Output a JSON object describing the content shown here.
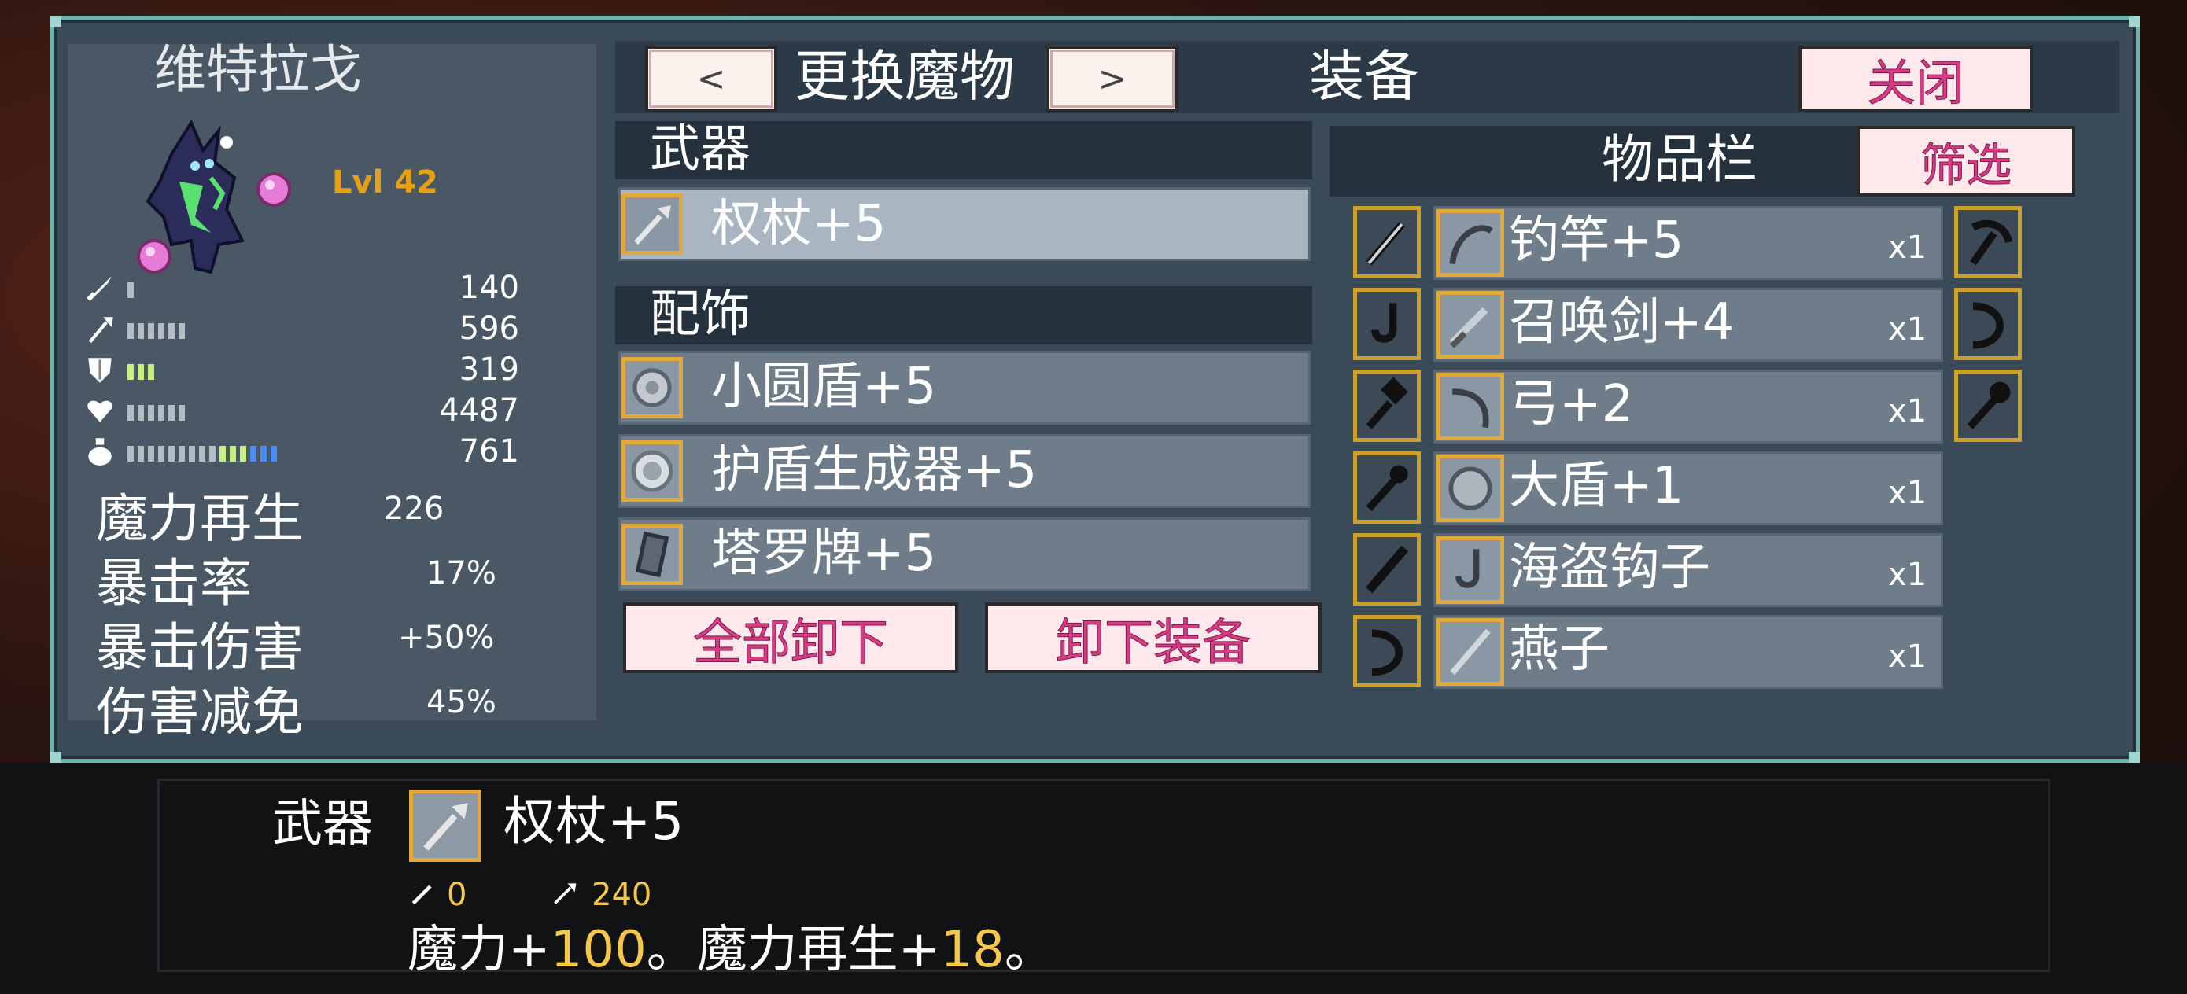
{
  "character": {
    "name": "维特拉戈",
    "level": "Lvl 42"
  },
  "stats": [
    {
      "icon": "sword-icon",
      "value": "140",
      "bars": [
        1,
        0,
        0
      ]
    },
    {
      "icon": "staff-icon",
      "value": "596",
      "bars": [
        6,
        0,
        0
      ]
    },
    {
      "icon": "shield-icon",
      "value": "319",
      "bars": [
        0,
        3,
        0
      ]
    },
    {
      "icon": "heart-icon",
      "value": "4487",
      "bars": [
        6,
        0,
        0
      ]
    },
    {
      "icon": "potion-icon",
      "value": "761",
      "bars": [
        9,
        3,
        3
      ]
    }
  ],
  "big_stats": [
    {
      "label": "魔力再生",
      "value": "226"
    },
    {
      "label": "暴击率",
      "value": "17%"
    },
    {
      "label": "暴击伤害",
      "value": "+50%"
    },
    {
      "label": "伤害减免",
      "value": "45%"
    }
  ],
  "header": {
    "prev": "<",
    "change_monster": "更换魔物",
    "next": ">",
    "title": "装备",
    "close": "关闭"
  },
  "equipment": {
    "weapon_section": "武器",
    "weapon": "权杖+5",
    "accessory_section": "配饰",
    "accessories": [
      "小圆盾+5",
      "护盾生成器+5",
      "塔罗牌+5"
    ],
    "unequip_all": "全部卸下",
    "unequip": "卸下装备"
  },
  "inventory": {
    "title": "物品栏",
    "filter": "筛选",
    "items": [
      {
        "name": "钓竿+5",
        "count": "x1",
        "icon": "fishing-rod-icon"
      },
      {
        "name": "召唤剑+4",
        "count": "x1",
        "icon": "sword-icon"
      },
      {
        "name": "弓+2",
        "count": "x1",
        "icon": "bow-icon"
      },
      {
        "name": "大盾+1",
        "count": "x1",
        "icon": "round-shield-icon"
      },
      {
        "name": "海盗钩子",
        "count": "x1",
        "icon": "hook-icon"
      },
      {
        "name": "燕子",
        "count": "x1",
        "icon": "dagger-icon"
      }
    ]
  },
  "detail": {
    "category": "武器",
    "name": "权杖+5",
    "attack": "0",
    "magic": "240",
    "desc_a": "魔力+",
    "desc_a_val": "100",
    "desc_sep": "。",
    "desc_b": "魔力再生+",
    "desc_b_val": "18",
    "desc_end": "。"
  },
  "colors": {
    "accent_pink": "#d93a86",
    "gold_border": "#e2a93a",
    "highlight_yellow": "#f5c84a",
    "panel_border": "#6fb5ad"
  }
}
